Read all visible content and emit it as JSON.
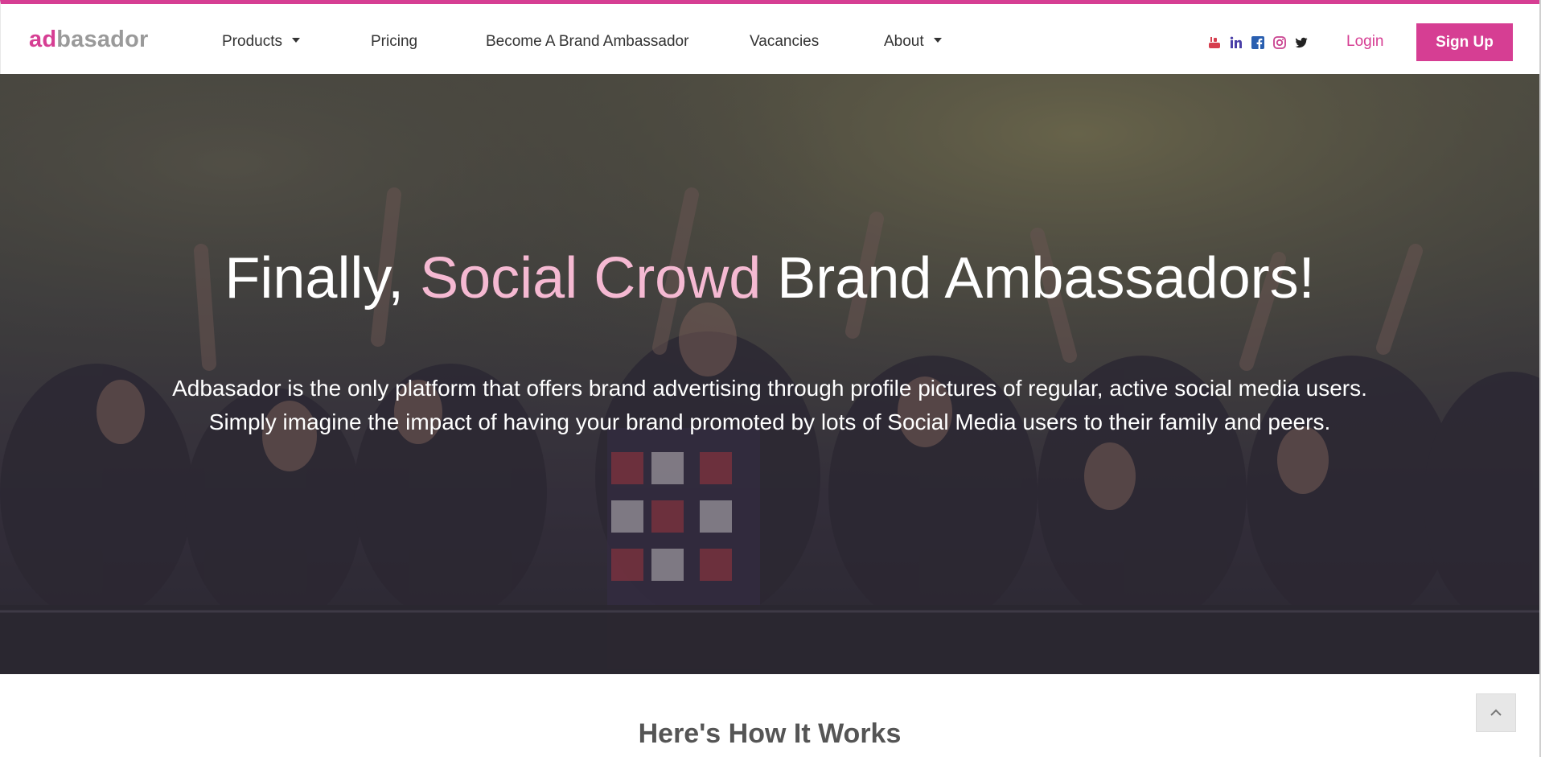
{
  "brand": {
    "logo_part1": "ad",
    "logo_part2": "basador",
    "accent_color": "#d63e93",
    "logo_gray": "#9a9a9a"
  },
  "nav": {
    "items": [
      {
        "label": "Products",
        "has_dropdown": true
      },
      {
        "label": "Pricing",
        "has_dropdown": false
      },
      {
        "label": "Become A Brand Ambassador",
        "has_dropdown": false
      },
      {
        "label": "Vacancies",
        "has_dropdown": false
      },
      {
        "label": "About",
        "has_dropdown": true
      }
    ],
    "social_icons": [
      "youtube-icon",
      "linkedin-icon",
      "facebook-icon",
      "instagram-icon",
      "twitter-icon"
    ],
    "login_label": "Login",
    "signup_label": "Sign Up"
  },
  "hero": {
    "title_part1": "Finally, ",
    "title_accent": "Social Crowd",
    "title_part2": " Brand Ambassadors!",
    "line1": "Adbasador is the only platform that offers brand advertising through profile pictures of regular, active social media users.",
    "line2": "Simply imagine the impact of having your brand promoted by lots of Social Media users to their family and peers.",
    "title_accent_color": "#f5b9d2"
  },
  "how": {
    "title": "Here's How It Works"
  },
  "back_to_top": {
    "icon": "chevron-up-icon"
  }
}
